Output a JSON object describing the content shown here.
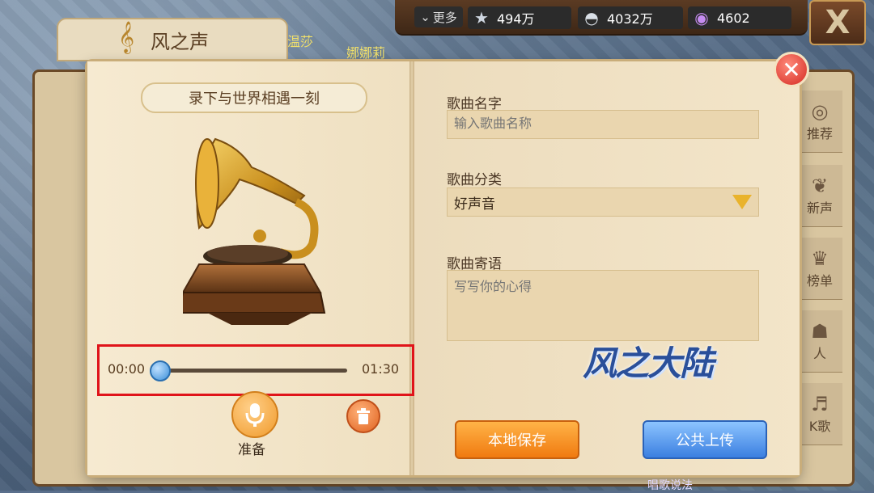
{
  "topbar": {
    "more_label": "更多",
    "resources": [
      {
        "icon": "star-icon",
        "value": "494万"
      },
      {
        "icon": "shell-icon",
        "value": "4032万"
      },
      {
        "icon": "pearl-icon",
        "value": "4602"
      }
    ]
  },
  "background": {
    "tab_title": "风之声",
    "player_name_1": "温莎",
    "player_name_2": "娜娜莉",
    "side_tabs": [
      "推荐",
      "新声",
      "榜单",
      "人",
      "K歌"
    ],
    "bottom_text": "唱歌说法"
  },
  "dialog": {
    "banner": "录下与世界相遇一刻",
    "progress": {
      "start_time": "00:00",
      "end_time": "01:30",
      "position": 0.0
    },
    "mic_label": "准备",
    "form": {
      "song_name_label": "歌曲名字",
      "song_name_placeholder": "输入歌曲名称",
      "category_label": "歌曲分类",
      "category_value": "好声音",
      "message_label": "歌曲寄语",
      "message_placeholder": "写写你的心得"
    },
    "logo_text": "风之大陆",
    "buttons": {
      "save": "本地保存",
      "upload": "公共上传"
    }
  },
  "colors": {
    "accent_orange": "#f07a10",
    "accent_blue": "#3b7fe0",
    "highlight_red": "#e0141a"
  }
}
